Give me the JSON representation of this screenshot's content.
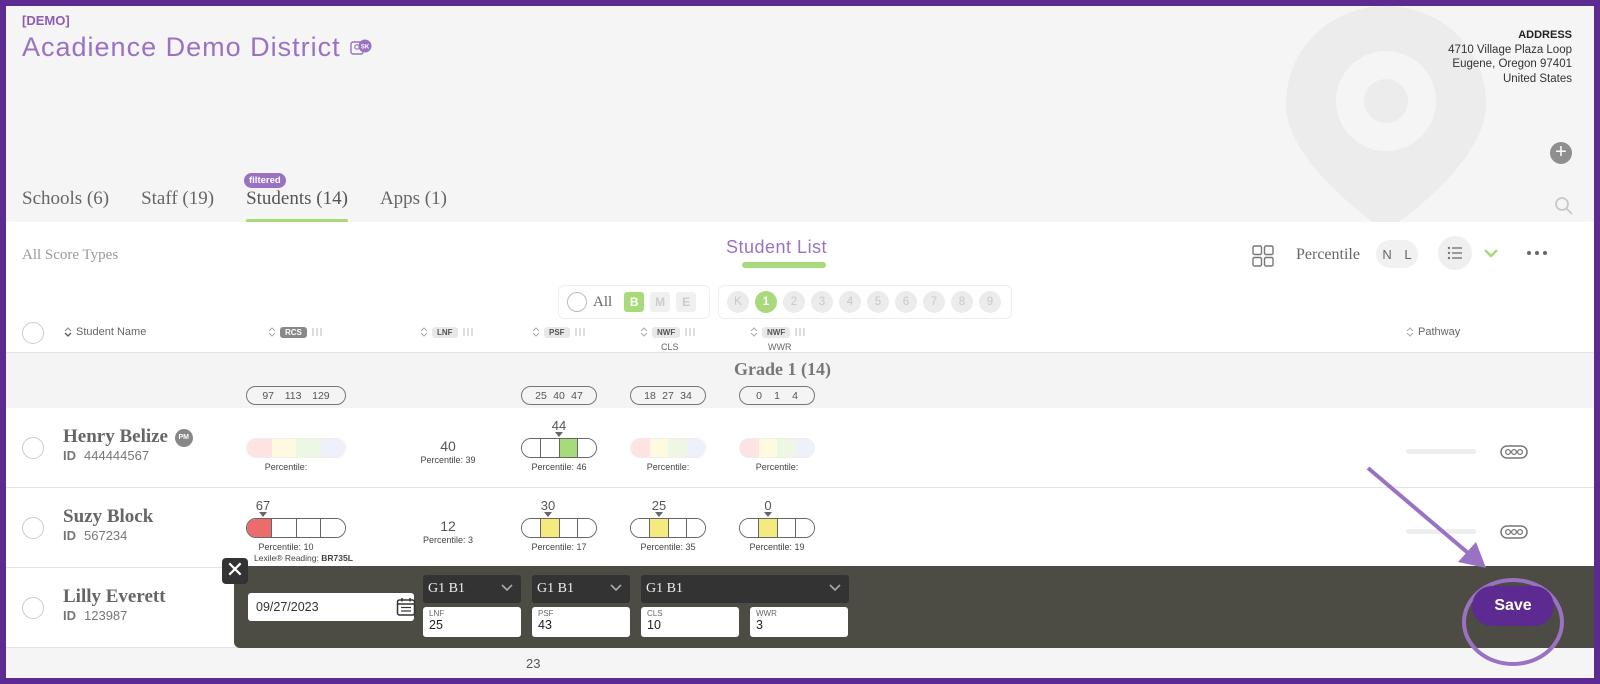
{
  "header": {
    "demo_tag": "[DEMO]",
    "district_title": "Acadience Demo District",
    "district_badge_text": "SK",
    "address_label": "ADDRESS",
    "address_lines": [
      "4710 Village Plaza Loop",
      "Eugene, Oregon 97401",
      "United States"
    ]
  },
  "tabs": [
    {
      "label": "Schools (6)"
    },
    {
      "label": "Staff (19)"
    },
    {
      "label": "Students (14)",
      "active": true,
      "badge": "filtered"
    },
    {
      "label": "Apps (1)"
    }
  ],
  "toolbar": {
    "score_types": "All Score Types",
    "list_title": "Student List",
    "percentile_label": "Percentile",
    "toggle_n": "N",
    "toggle_l": "L"
  },
  "filters": {
    "all_label": "All",
    "periods": [
      "B",
      "M",
      "E"
    ],
    "active_period": "B",
    "grades": [
      "K",
      "1",
      "2",
      "3",
      "4",
      "5",
      "6",
      "7",
      "8",
      "9"
    ],
    "active_grade": "1"
  },
  "columns": {
    "student_name": "Student Name",
    "rcs": "RCS",
    "lnf": "LNF",
    "psf": "PSF",
    "nwf_cls": "NWF",
    "nwf_cls_sub": "CLS",
    "nwf_wwr": "NWF",
    "nwf_wwr_sub": "WWR",
    "pathway": "Pathway"
  },
  "grade_group": {
    "title": "Grade 1 (14)",
    "benchmarks": {
      "rcs": [
        "97",
        "113",
        "129"
      ],
      "psf": [
        "25",
        "40",
        "47"
      ],
      "nwf_cls": [
        "18",
        "27",
        "34"
      ],
      "nwf_wwr": [
        "0",
        "1",
        "4"
      ]
    }
  },
  "students": [
    {
      "name": "Henry Belize",
      "badge": "PM",
      "id_label": "ID",
      "id": "444444567",
      "lnf": "40",
      "lnf_pct": "Percentile: 39",
      "psf": "44",
      "psf_pct": "Percentile: 46",
      "rcs_pct": "Percentile:",
      "cls_pct": "Percentile:",
      "wwr_pct": "Percentile:"
    },
    {
      "name": "Suzy Block",
      "id_label": "ID",
      "id": "567234",
      "rcs": "67",
      "rcs_pct": "Percentile: 10",
      "lexile_label": "Lexile® Reading:",
      "lexile": "BR735L",
      "lnf": "12",
      "lnf_pct": "Percentile: 3",
      "psf": "30",
      "psf_pct": "Percentile: 17",
      "cls": "25",
      "cls_pct": "Percentile: 35",
      "wwr": "0",
      "wwr_pct": "Percentile: 19"
    },
    {
      "name": "Lilly Everett",
      "id_label": "ID",
      "id": "123987"
    }
  ],
  "entry": {
    "date": "09/27/2023",
    "dropdowns": [
      "G1 B1",
      "G1 B1",
      "G1 B1"
    ],
    "inputs": [
      {
        "label": "LNF",
        "value": "25"
      },
      {
        "label": "PSF",
        "value": "43"
      },
      {
        "label": "CLS",
        "value": "10"
      },
      {
        "label": "WWR",
        "value": "3"
      }
    ],
    "save_label": "Save"
  },
  "next_row_value": "23",
  "colors": {
    "brand_purple": "#5d2a91",
    "accent_lilac": "#9a72c4",
    "accent_green": "#a8d97a",
    "score_red": "#ec6b6b",
    "score_yellow": "#f5ea80",
    "score_green": "#a8d97a"
  }
}
